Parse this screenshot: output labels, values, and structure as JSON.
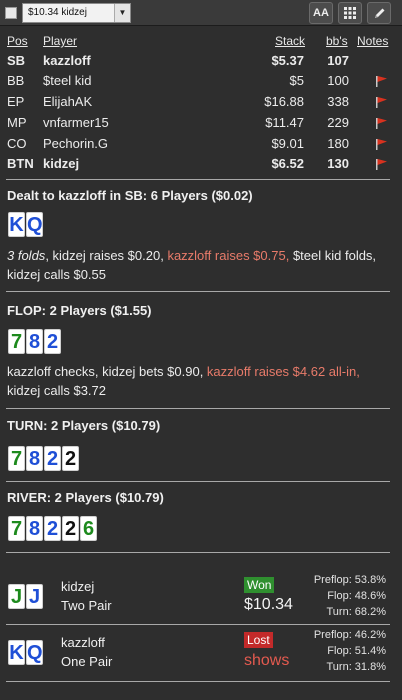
{
  "toolbar": {
    "session_value": "$10.34 kidzej",
    "font_button_label": "AA"
  },
  "table": {
    "headers": {
      "pos": "Pos",
      "player": "Player",
      "stack": "Stack",
      "bbs": "bb's",
      "notes": "Notes"
    },
    "rows": [
      {
        "pos": "SB",
        "player": "kazzloff",
        "stack": "$5.37",
        "bbs": "107",
        "note_flag": false,
        "bold": true
      },
      {
        "pos": "BB",
        "player": "$teel kid",
        "stack": "$5",
        "bbs": "100",
        "note_flag": true,
        "bold": false
      },
      {
        "pos": "EP",
        "player": "ElijahAK",
        "stack": "$16.88",
        "bbs": "338",
        "note_flag": true,
        "bold": false
      },
      {
        "pos": "MP",
        "player": "vnfarmer15",
        "stack": "$11.47",
        "bbs": "229",
        "note_flag": true,
        "bold": false
      },
      {
        "pos": "CO",
        "player": "Pechorin.G",
        "stack": "$9.01",
        "bbs": "180",
        "note_flag": true,
        "bold": false
      },
      {
        "pos": "BTN",
        "player": "kidzej",
        "stack": "$6.52",
        "bbs": "130",
        "note_flag": true,
        "bold": true
      }
    ]
  },
  "preflop": {
    "title": "Dealt to kazzloff in SB: 6 Players ($0.02)",
    "cards": [
      {
        "rank": "K",
        "color": "blue"
      },
      {
        "rank": "Q",
        "color": "blue"
      }
    ],
    "actions": {
      "a1": "3 folds",
      "a2": ", kidzej raises $0.20, ",
      "a3": "kazzloff raises $0.75,",
      "a4": " $teel kid folds, kidzej calls $0.55"
    }
  },
  "flop": {
    "title": "FLOP: 2 Players ($1.55)",
    "cards": [
      {
        "rank": "7",
        "color": "green"
      },
      {
        "rank": "8",
        "color": "blue"
      },
      {
        "rank": "2",
        "color": "blue"
      }
    ],
    "actions": {
      "a1": "kazzloff checks, kidzej bets $0.90, ",
      "a2": "kazzloff raises $4.62 all-in,",
      "a3": " kidzej calls $3.72"
    }
  },
  "turn": {
    "title": "TURN: 2 Players ($10.79)",
    "cards": [
      {
        "rank": "7",
        "color": "green"
      },
      {
        "rank": "8",
        "color": "blue"
      },
      {
        "rank": "2",
        "color": "blue"
      },
      {
        "rank": "2",
        "color": "black"
      }
    ]
  },
  "river": {
    "title": "RIVER: 2 Players ($10.79)",
    "cards": [
      {
        "rank": "7",
        "color": "green"
      },
      {
        "rank": "8",
        "color": "blue"
      },
      {
        "rank": "2",
        "color": "blue"
      },
      {
        "rank": "2",
        "color": "black"
      },
      {
        "rank": "6",
        "color": "green"
      }
    ]
  },
  "results": [
    {
      "player": "kidzej",
      "hand": "Two Pair",
      "cards": [
        {
          "rank": "J",
          "color": "green"
        },
        {
          "rank": "J",
          "color": "blue"
        }
      ],
      "badge": "Won",
      "outcome": "$10.34",
      "equity": {
        "preflop": "Preflop: 53.8%",
        "flop": "Flop: 48.6%",
        "turn": "Turn: 68.2%"
      }
    },
    {
      "player": "kazzloff",
      "hand": "One Pair",
      "cards": [
        {
          "rank": "K",
          "color": "blue"
        },
        {
          "rank": "Q",
          "color": "blue"
        }
      ],
      "badge": "Lost",
      "outcome": "shows",
      "equity": {
        "preflop": "Preflop: 46.2%",
        "flop": "Flop: 51.4%",
        "turn": "Turn: 31.8%"
      }
    }
  ],
  "colors": {
    "background": "#2e2e2e",
    "highlight_action": "#e87b6a",
    "won_badge": "#2f8f2f",
    "lost_badge": "#c32a2a",
    "flag": "#d8321f"
  },
  "icons": {
    "checkbox": "checkbox",
    "dropdown": "chevron-down-icon",
    "font_size": "font-size-icon",
    "grid": "grid-icon",
    "edit": "pencil-icon",
    "note_flag": "flag-icon"
  }
}
